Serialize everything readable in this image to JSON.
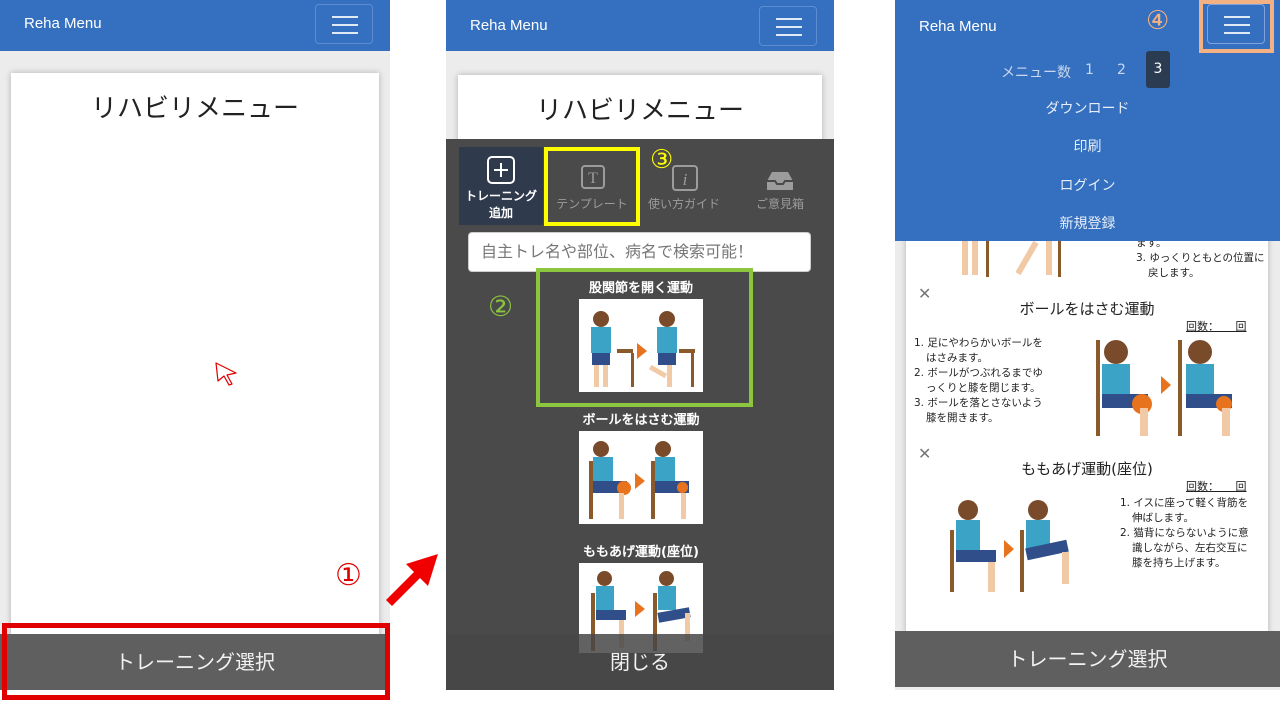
{
  "app": {
    "brand": "Reha Menu"
  },
  "icons": {
    "menu": "hamburger-menu-icon",
    "pointer": "mouse-pointer-icon",
    "arrow": "arrow-up-right-icon",
    "add": "plus-square-icon",
    "template": "template-icon",
    "guide": "info-icon",
    "feedback": "inbox-icon",
    "close": "close-x-icon"
  },
  "colors": {
    "navbar": "#3470bf",
    "overlay": "#4a4a4a",
    "bottom_bar": "#5f5f5f",
    "highlight_red": "#e00000",
    "highlight_yellow": "#ffff00",
    "highlight_green": "#8cc63f",
    "highlight_orange": "#f4b183"
  },
  "screen1": {
    "page_title": "リハビリメニュー",
    "bottom_button": "トレーニング選択",
    "step_marker": "①"
  },
  "screen2": {
    "page_title": "リハビリメニュー",
    "tools": [
      {
        "label": "トレーニング追加",
        "line1": "トレーニング",
        "line2": "追加"
      },
      {
        "label": "テンプレート"
      },
      {
        "label": "使い方ガイド"
      },
      {
        "label": "ご意見箱"
      }
    ],
    "search_placeholder": "自主トレ名や部位、病名で検索可能！",
    "exercises": [
      {
        "name": "股関節を開く運動"
      },
      {
        "name": "ボールをはさむ運動"
      },
      {
        "name": "ももあげ運動(座位)"
      }
    ],
    "close_button": "閉じる",
    "marker_2": "②",
    "marker_3": "③"
  },
  "screen3": {
    "menu": {
      "count_label": "メニュー数",
      "counts": [
        "1",
        "2",
        "3"
      ],
      "active_count": "3",
      "items": [
        "ダウンロード",
        "印刷",
        "ログイン",
        "新規登録"
      ]
    },
    "marker_4": "④",
    "top_partial": {
      "l1": "ます。",
      "l2": "3. ゆっくりともとの位置に",
      "l3": "戻します。"
    },
    "sections": [
      {
        "title": "ボールをはさむ運動",
        "count_label": "回数：　　回",
        "steps": [
          "1. 足にやわらかいボールを",
          "はさみます。",
          "2. ボールがつぶれるまでゆ",
          "っくりと膝を閉じます。",
          "3. ボールを落とさないよう",
          "膝を開きます。"
        ]
      },
      {
        "title": "ももあげ運動(座位)",
        "count_label": "回数：　　回",
        "steps": [
          "1. イスに座って軽く背筋を",
          "伸ばします。",
          "2. 猫背にならないように意",
          "識しながら、左右交互に",
          "膝を持ち上げます。"
        ]
      }
    ],
    "bottom_button": "トレーニング選択"
  }
}
